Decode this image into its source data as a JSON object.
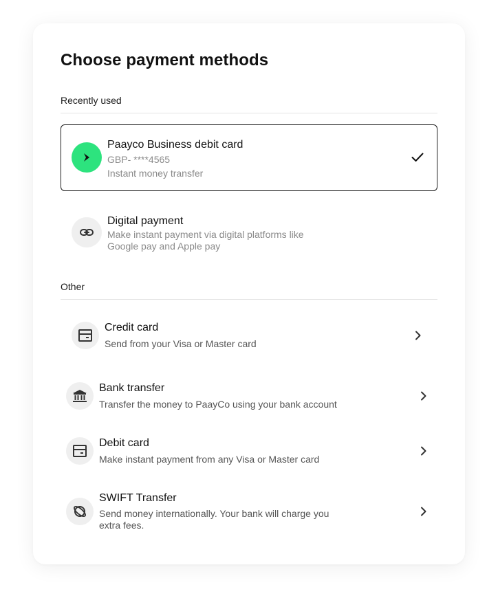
{
  "title": "Choose payment methods",
  "sections": {
    "recent_label": "Recently used",
    "other_label": "Other"
  },
  "recent": [
    {
      "title": "Paayco Business debit card",
      "line1": "GBP- ****4565",
      "line2": "Instant money transfer",
      "icon": "paayco-logo-icon",
      "selected": true
    },
    {
      "title": "Digital payment",
      "line1": "Make instant payment via digital platforms like",
      "line2": "Google pay and Apple pay",
      "icon": "link-icon",
      "selected": false
    }
  ],
  "other": [
    {
      "title": "Credit card",
      "line1": "Send from your Visa or Master card",
      "icon": "card-icon"
    },
    {
      "title": "Bank transfer",
      "line1": "Transfer the money to PaayCo using your bank account",
      "icon": "bank-icon"
    },
    {
      "title": "Debit card",
      "line1": "Make instant payment from any Visa or Master card",
      "icon": "card-icon"
    },
    {
      "title": "SWIFT Transfer",
      "line1": "Send money internationally. Your bank will charge you",
      "line2": "extra fees.",
      "icon": "globe-icon"
    }
  ],
  "colors": {
    "accent": "#2de37e",
    "icon_bg": "#efefef",
    "muted_text": "#8a8a8a"
  }
}
